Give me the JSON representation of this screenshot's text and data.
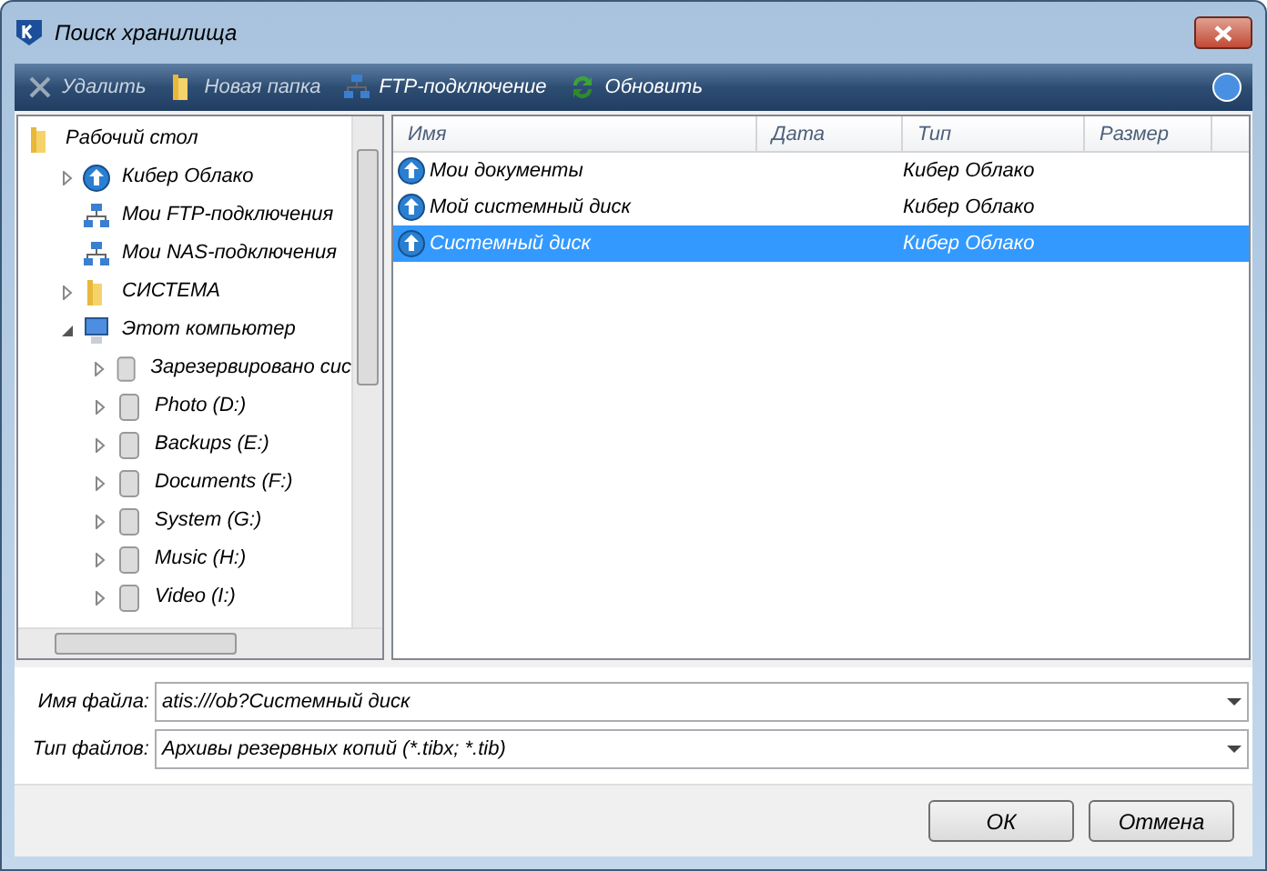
{
  "window": {
    "title": "Поиск хранилища"
  },
  "toolbar": [
    {
      "label": "Удалить",
      "kind": "delete",
      "disabled": true
    },
    {
      "label": "Новая папка",
      "kind": "folder",
      "disabled": true
    },
    {
      "label": "FTP-подключение",
      "kind": "network",
      "disabled": false
    },
    {
      "label": "Обновить",
      "kind": "refresh",
      "disabled": false
    }
  ],
  "tree": [
    {
      "label": "Рабочий стол",
      "kind": "folder",
      "children": [
        {
          "label": "Кибер Облако",
          "kind": "cloud",
          "expanded": false,
          "expandable": true
        },
        {
          "label": "Мои FTP-подключения",
          "kind": "network",
          "expandable": false
        },
        {
          "label": "Мои NAS-подключения",
          "kind": "network",
          "expandable": false
        },
        {
          "label": "СИСТЕМА",
          "kind": "folder",
          "expanded": false,
          "expandable": true
        },
        {
          "label": "Этот компьютер",
          "kind": "computer",
          "expanded": true,
          "expandable": true,
          "children": [
            {
              "label": "Зарезервировано сис",
              "kind": "drive",
              "expanded": false,
              "expandable": true
            },
            {
              "label": "Photo (D:)",
              "kind": "drive",
              "expanded": false,
              "expandable": true
            },
            {
              "label": "Backups (E:)",
              "kind": "drive",
              "expanded": false,
              "expandable": true
            },
            {
              "label": "Documents (F:)",
              "kind": "drive",
              "expanded": false,
              "expandable": true
            },
            {
              "label": "System (G:)",
              "kind": "drive",
              "expanded": false,
              "expandable": true
            },
            {
              "label": "Music (H:)",
              "kind": "drive",
              "expanded": false,
              "expandable": true
            },
            {
              "label": "Video (I:)",
              "kind": "drive",
              "expanded": false,
              "expandable": true
            }
          ]
        }
      ]
    }
  ],
  "table": {
    "columns": [
      "Имя",
      "Дата",
      "Тип",
      "Размер"
    ],
    "rows": [
      {
        "name": "Мои документы",
        "type": "Кибер Облако",
        "selected": false
      },
      {
        "name": "Мой системный диск",
        "type": "Кибер Облако",
        "selected": false
      },
      {
        "name": "Системный диск",
        "type": "Кибер Облако",
        "selected": true
      }
    ]
  },
  "fields": [
    {
      "label": "Имя файла:",
      "value": "atis:///ob?Системный диск"
    },
    {
      "label": "Тип файлов:",
      "value": "Архивы резервных копий (*.tibx; *.tib)"
    }
  ],
  "buttons": [
    "ОК",
    "Отмена"
  ]
}
